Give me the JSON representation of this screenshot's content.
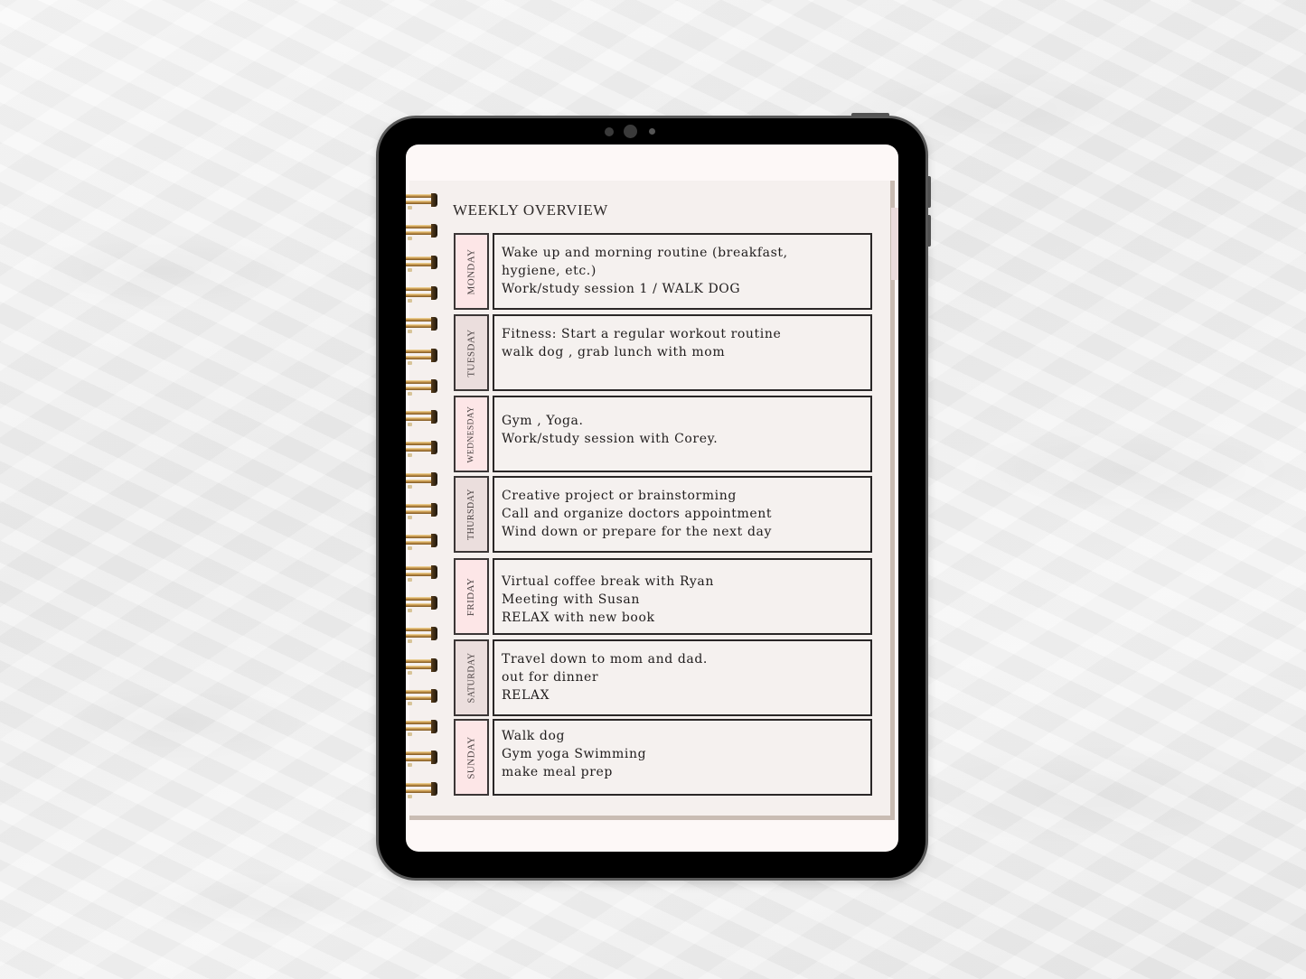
{
  "page": {
    "title": "WEEKLY OVERVIEW"
  },
  "colors": {
    "label_pink": "#fde6e7",
    "label_mauve": "#ebdedd",
    "box_bg": "#f5f1ef",
    "page_bg": "#f5f0ee",
    "ring_gold": "#c7974c"
  },
  "days": [
    {
      "name": "MONDAY",
      "lines": [
        "Wake up and morning routine (breakfast,",
        "hygiene, etc.)",
        "Work/study session 1 / WALK DOG"
      ]
    },
    {
      "name": "TUESDAY",
      "lines": [
        "Fitness: Start a regular workout routine",
        "walk dog , grab lunch with mom",
        ""
      ]
    },
    {
      "name": "WEDNESDAY",
      "lines": [
        "Gym , Yoga.",
        "Work/study session with Corey.",
        ""
      ]
    },
    {
      "name": "THURSDAY",
      "lines": [
        "Creative project or brainstorming",
        "Call and organize doctors appointment",
        "Wind down or prepare for the next day"
      ]
    },
    {
      "name": "FRIDAY",
      "lines": [
        "Virtual coffee break with Ryan",
        "Meeting with Susan",
        "RELAX with new book"
      ]
    },
    {
      "name": "SATURDAY",
      "lines": [
        "Travel down to mom and dad.",
        "out for dinner",
        "RELAX"
      ]
    },
    {
      "name": "SUNDAY",
      "lines": [
        "Walk dog",
        "Gym yoga Swimming",
        "make meal prep"
      ]
    }
  ]
}
